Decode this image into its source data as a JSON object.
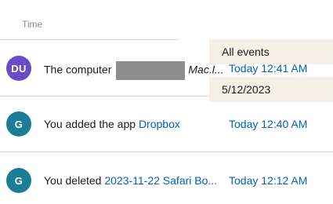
{
  "table": {
    "time_header": "Time"
  },
  "events": [
    {
      "avatar_initials": "DU",
      "avatar_color": "#6b4bc9",
      "text_prefix": "The computer",
      "device_name": "Mac.l...",
      "time": "Today 12:41 AM"
    },
    {
      "avatar_initials": "G",
      "avatar_color": "#1a7f96",
      "text_prefix": "You added the app",
      "link_text": "Dropbox",
      "time": "Today 12:40 AM"
    },
    {
      "avatar_initials": "G",
      "avatar_color": "#1a7f96",
      "text_prefix": "You deleted",
      "link_text": "2023-11-22 Safari Bo...",
      "time": "Today 12:12 AM"
    }
  ],
  "filters": {
    "event_filter": "All events",
    "date_filter": "5/12/2023"
  },
  "colors": {
    "link": "#0061c1",
    "filter_background": "#f5efe6",
    "redaction": "#8d8d8d"
  }
}
